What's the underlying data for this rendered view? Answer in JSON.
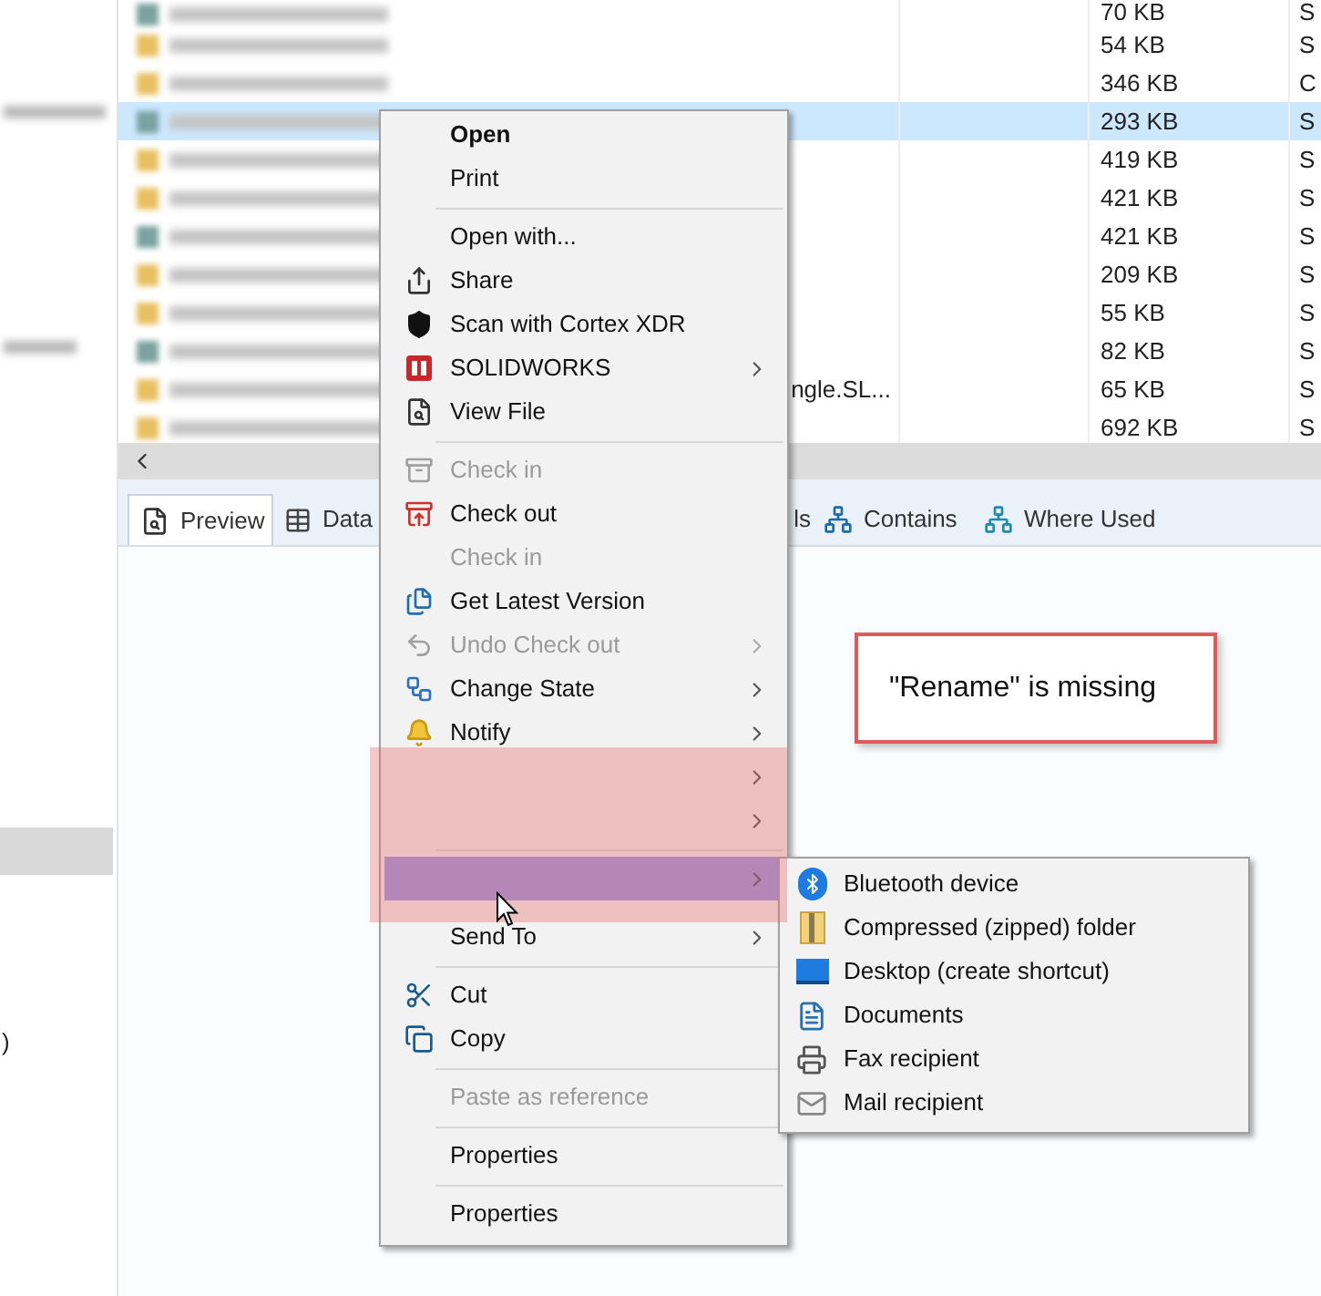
{
  "sidebar": {
    "fragment": ")"
  },
  "file_list": {
    "rows": [
      {
        "size": "70 KB",
        "type": "S",
        "selected": false
      },
      {
        "size": "54 KB",
        "type": "S",
        "selected": false
      },
      {
        "size": "346 KB",
        "type": "C",
        "selected": false
      },
      {
        "size": "293 KB",
        "type": "S",
        "selected": true
      },
      {
        "size": "419 KB",
        "type": "S",
        "selected": false
      },
      {
        "size": "421 KB",
        "type": "S",
        "selected": false
      },
      {
        "size": "421 KB",
        "type": "S",
        "selected": false
      },
      {
        "size": "209 KB",
        "type": "S",
        "selected": false
      },
      {
        "size": "55 KB",
        "type": "S",
        "selected": false
      },
      {
        "size": "82 KB",
        "type": "S",
        "selected": false
      },
      {
        "name": "ngle.SL...",
        "size": "65 KB",
        "type": "S",
        "selected": false
      },
      {
        "size": "692 KB",
        "type": "S",
        "selected": false
      }
    ]
  },
  "tabs": [
    {
      "label": "Preview",
      "selected": true
    },
    {
      "label": "Data",
      "selected": false
    },
    {
      "label": "ls",
      "selected": false
    },
    {
      "label": "Contains",
      "selected": false
    },
    {
      "label": "Where Used",
      "selected": false
    }
  ],
  "callout": {
    "text": "\"Rename\" is missing"
  },
  "context_menu": {
    "items": [
      {
        "kind": "item",
        "label": "Open",
        "bold": true,
        "disabled": false,
        "submenu": false,
        "selected": false
      },
      {
        "kind": "item",
        "label": "Print",
        "bold": false,
        "disabled": false,
        "submenu": false,
        "selected": false
      },
      {
        "kind": "separator"
      },
      {
        "kind": "item",
        "label": "Open with...",
        "bold": false,
        "disabled": false,
        "submenu": false,
        "selected": false
      },
      {
        "kind": "item",
        "label": "Share",
        "bold": false,
        "disabled": false,
        "submenu": false,
        "selected": false
      },
      {
        "kind": "item",
        "label": "Scan with Cortex XDR",
        "bold": false,
        "disabled": false,
        "submenu": false,
        "selected": false
      },
      {
        "kind": "item",
        "label": "SOLIDWORKS",
        "bold": false,
        "disabled": false,
        "submenu": true,
        "selected": false
      },
      {
        "kind": "item",
        "label": "View File",
        "bold": false,
        "disabled": false,
        "submenu": false,
        "selected": false
      },
      {
        "kind": "separator"
      },
      {
        "kind": "item",
        "label": "Check in",
        "bold": false,
        "disabled": true,
        "submenu": false,
        "selected": false
      },
      {
        "kind": "item",
        "label": "Check out",
        "bold": false,
        "disabled": false,
        "submenu": false,
        "selected": false
      },
      {
        "kind": "item",
        "label": "Check in",
        "bold": false,
        "disabled": true,
        "submenu": false,
        "selected": false
      },
      {
        "kind": "item",
        "label": "Get Latest Version",
        "bold": false,
        "disabled": false,
        "submenu": false,
        "selected": false
      },
      {
        "kind": "item",
        "label": "Undo Check out",
        "bold": false,
        "disabled": true,
        "submenu": true,
        "selected": false
      },
      {
        "kind": "item",
        "label": "Change State",
        "bold": false,
        "disabled": false,
        "submenu": true,
        "selected": false
      },
      {
        "kind": "item",
        "label": "Notify",
        "bold": false,
        "disabled": false,
        "submenu": true,
        "selected": false
      },
      {
        "kind": "item",
        "bold": false,
        "disabled": false,
        "submenu": true,
        "selected": false
      },
      {
        "kind": "item",
        "bold": false,
        "disabled": false,
        "submenu": true,
        "selected": false
      },
      {
        "kind": "separator"
      },
      {
        "kind": "item",
        "bold": false,
        "disabled": false,
        "submenu": true,
        "selected": true
      },
      {
        "kind": "item",
        "label": "Send To",
        "bold": false,
        "disabled": false,
        "submenu": true,
        "selected": false
      },
      {
        "kind": "separator"
      },
      {
        "kind": "item",
        "label": "Cut",
        "bold": false,
        "disabled": false,
        "submenu": false,
        "selected": false
      },
      {
        "kind": "item",
        "label": "Copy",
        "bold": false,
        "disabled": false,
        "submenu": false,
        "selected": false
      },
      {
        "kind": "separator"
      },
      {
        "kind": "item",
        "label": "Paste as reference",
        "bold": false,
        "disabled": true,
        "submenu": false,
        "selected": false
      },
      {
        "kind": "separator"
      },
      {
        "kind": "item",
        "label": "Properties",
        "bold": false,
        "disabled": false,
        "submenu": false,
        "selected": false
      },
      {
        "kind": "separator"
      },
      {
        "kind": "item",
        "label": "Properties",
        "bold": false,
        "disabled": false,
        "submenu": false,
        "selected": false
      }
    ]
  },
  "submenu": {
    "items": [
      {
        "label": "Bluetooth device"
      },
      {
        "label": "Compressed (zipped) folder"
      },
      {
        "label": "Desktop (create shortcut)"
      },
      {
        "label": "Documents"
      },
      {
        "label": "Fax recipient"
      },
      {
        "label": "Mail recipient"
      }
    ]
  }
}
